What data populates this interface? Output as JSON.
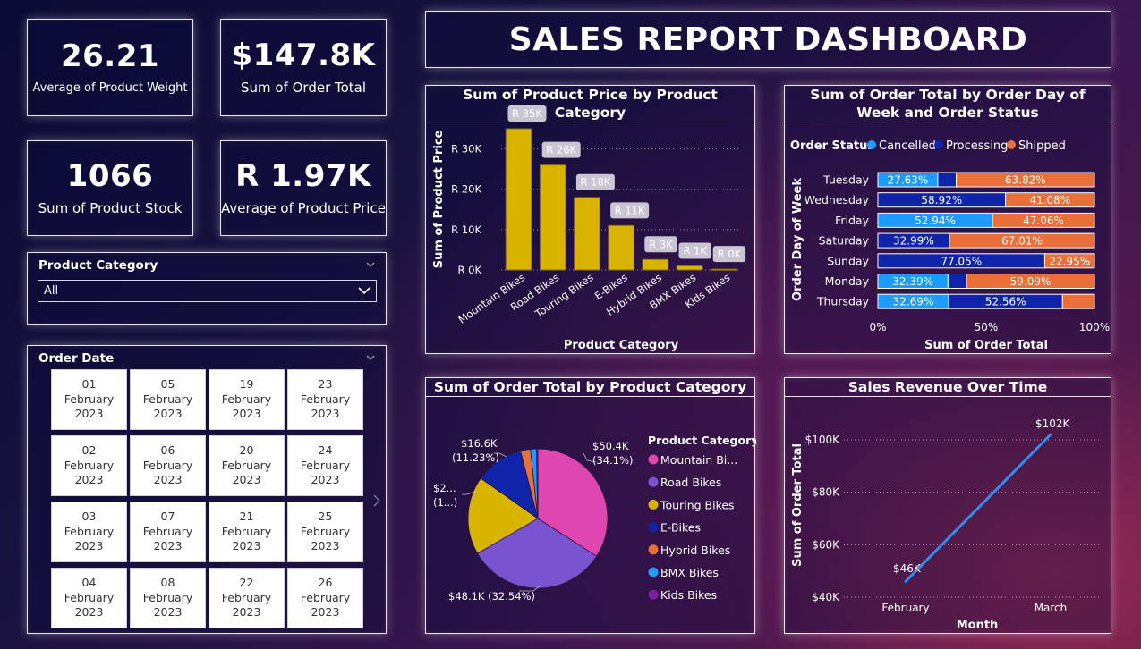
{
  "dashboard": {
    "title": "SALES REPORT DASHBOARD"
  },
  "kpis": [
    {
      "value": "26.21",
      "label": "Average of Product Weight"
    },
    {
      "value": "$147.8K",
      "label": "Sum of Order Total"
    },
    {
      "value": "1066",
      "label": "Sum of Product Stock"
    },
    {
      "value": "R 1.97K",
      "label": "Average of Product Price"
    }
  ],
  "category_slicer": {
    "title": "Product Category",
    "selected": "All"
  },
  "date_slicer": {
    "title": "Order Date",
    "dates": [
      {
        "day": "01",
        "month": "February",
        "year": "2023"
      },
      {
        "day": "05",
        "month": "February",
        "year": "2023"
      },
      {
        "day": "19",
        "month": "February",
        "year": "2023"
      },
      {
        "day": "23",
        "month": "February",
        "year": "2023"
      },
      {
        "day": "02",
        "month": "February",
        "year": "2023"
      },
      {
        "day": "06",
        "month": "February",
        "year": "2023"
      },
      {
        "day": "20",
        "month": "February",
        "year": "2023"
      },
      {
        "day": "24",
        "month": "February",
        "year": "2023"
      },
      {
        "day": "03",
        "month": "February",
        "year": "2023"
      },
      {
        "day": "07",
        "month": "February",
        "year": "2023"
      },
      {
        "day": "21",
        "month": "February",
        "year": "2023"
      },
      {
        "day": "25",
        "month": "February",
        "year": "2023"
      },
      {
        "day": "04",
        "month": "February",
        "year": "2023"
      },
      {
        "day": "08",
        "month": "February",
        "year": "2023"
      },
      {
        "day": "22",
        "month": "February",
        "year": "2023"
      },
      {
        "day": "26",
        "month": "February",
        "year": "2023"
      }
    ]
  },
  "colors": {
    "bar_gold": "#d8b400",
    "bar_edge": "#8a7200",
    "cancelled": "#1e9bff",
    "processing": "#0f24a8",
    "shipped": "#ea6f3a",
    "line": "#2f8cf0",
    "pie_mountain": "#e046b0",
    "pie_road": "#7a53d0",
    "pie_touring": "#d8b400",
    "pie_ebikes": "#0f24a8",
    "pie_hybrid": "#ea6f3a",
    "pie_bmx": "#1e9bff",
    "pie_kids": "#7a1fa0"
  },
  "chart_data": [
    {
      "type": "bar",
      "title": "Sum of Product Price by Product Category",
      "xlabel": "Product Category",
      "ylabel": "Sum of Product Price",
      "categories": [
        "Mountain Bikes",
        "Road Bikes",
        "Touring Bikes",
        "E-Bikes",
        "Hybrid Bikes",
        "BMX Bikes",
        "Kids Bikes"
      ],
      "values": [
        35000,
        26000,
        18000,
        11000,
        2600,
        1000,
        200
      ],
      "data_labels": [
        "R 35K",
        "R 26K",
        "R 18K",
        "R 11K",
        "R 3K",
        "R 1K",
        "R 0K"
      ],
      "yticks": [
        "R 0K",
        "R 10K",
        "R 20K",
        "R 30K"
      ],
      "ylim": [
        0,
        35000
      ],
      "grid": true
    },
    {
      "type": "bar",
      "orientation": "horizontal",
      "stacked": "100%",
      "title": "Sum of Order Total by Order Day of Week and Order Status",
      "legend_title": "Order Status",
      "legend_position": "top",
      "xlabel": "Sum of Order Total",
      "ylabel": "Order Day of Week",
      "xticks": [
        "0%",
        "50%",
        "100%"
      ],
      "categories": [
        "Tuesday",
        "Wednesday",
        "Friday",
        "Saturday",
        "Sunday",
        "Monday",
        "Thursday"
      ],
      "series": [
        {
          "name": "Cancelled",
          "values": [
            27.63,
            0,
            52.94,
            0,
            0,
            32.39,
            32.69
          ],
          "labels": [
            "27.63%",
            "",
            "52.94%",
            "",
            "",
            "32.39%",
            "32.69%"
          ]
        },
        {
          "name": "Processing",
          "values": [
            8.55,
            58.92,
            0,
            32.99,
            77.05,
            8.52,
            52.56
          ],
          "labels": [
            "",
            "58.92%",
            "",
            "32.99%",
            "77.05%",
            "",
            "52.56%"
          ]
        },
        {
          "name": "Shipped",
          "values": [
            63.82,
            41.08,
            47.06,
            67.01,
            22.95,
            59.09,
            14.75
          ],
          "labels": [
            "63.82%",
            "41.08%",
            "47.06%",
            "67.01%",
            "22.95%",
            "59.09%",
            ""
          ]
        }
      ]
    },
    {
      "type": "pie",
      "title": "Sum of Order Total by Product Category",
      "legend_title": "Product Category",
      "legend_position": "right",
      "slices": [
        {
          "name": "Mountain Bikes",
          "legend": "Mountain Bi...",
          "value": 50.4,
          "percent": 34.1,
          "label": "$50.4K",
          "label2": "(34.1%)"
        },
        {
          "name": "Road Bikes",
          "legend": "Road Bikes",
          "value": 48.1,
          "percent": 32.54,
          "label": "$48.1K (32.54%)",
          "label2": ""
        },
        {
          "name": "Touring Bikes",
          "legend": "Touring Bikes",
          "value": 26.8,
          "percent": 18.13,
          "label": "$2...",
          "label2": "(1...)"
        },
        {
          "name": "E-Bikes",
          "legend": "E-Bikes",
          "value": 16.6,
          "percent": 11.23,
          "label": "$16.6K",
          "label2": "(11.23%)"
        },
        {
          "name": "Hybrid Bikes",
          "legend": "Hybrid Bikes",
          "value": 3.4,
          "percent": 2.3,
          "label": "",
          "label2": ""
        },
        {
          "name": "BMX Bikes",
          "legend": "BMX Bikes",
          "value": 2.0,
          "percent": 1.35,
          "label": "",
          "label2": ""
        },
        {
          "name": "Kids Bikes",
          "legend": "Kids Bikes",
          "value": 0.5,
          "percent": 0.35,
          "label": "",
          "label2": ""
        }
      ]
    },
    {
      "type": "line",
      "title": "Sales Revenue Over Time",
      "xlabel": "Month",
      "ylabel": "Sum of Order Total",
      "x": [
        "February",
        "March"
      ],
      "values": [
        46000,
        102000
      ],
      "data_labels": [
        "$46K",
        "$102K"
      ],
      "yticks": [
        {
          "value": 40000,
          "label": "$40K"
        },
        {
          "value": 60000,
          "label": "$60K"
        },
        {
          "value": 80000,
          "label": "$80K"
        },
        {
          "value": 100000,
          "label": "$100K"
        }
      ],
      "ylim": [
        40000,
        102000
      ],
      "grid": true
    }
  ]
}
